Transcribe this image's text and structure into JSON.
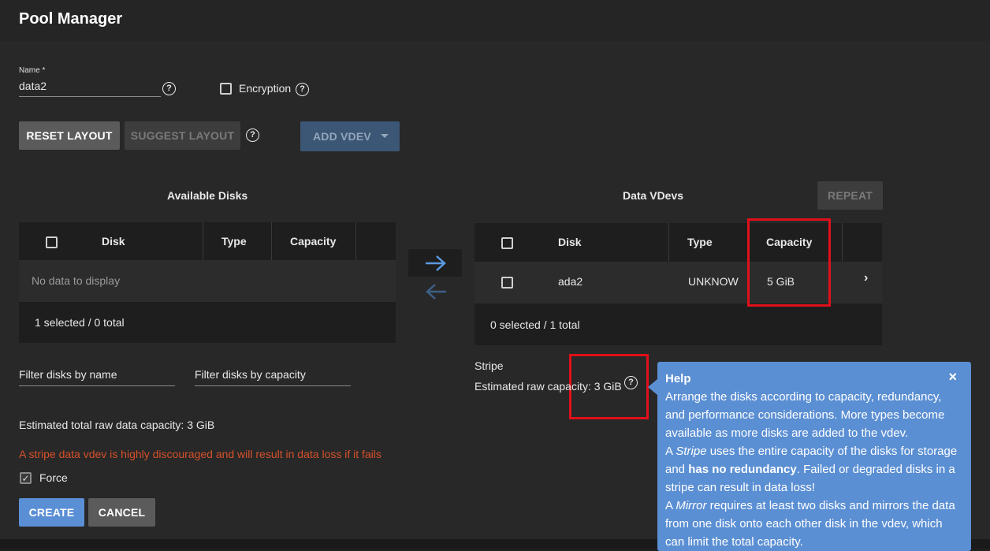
{
  "header": {
    "title": "Pool Manager"
  },
  "form": {
    "name_label": "Name *",
    "name_value": "data2",
    "encryption_label": "Encryption"
  },
  "toolbar": {
    "reset_layout": "RESET LAYOUT",
    "suggest_layout": "SUGGEST LAYOUT",
    "add_vdev": "ADD VDEV"
  },
  "available_disks": {
    "title": "Available Disks",
    "columns": [
      "Disk",
      "Type",
      "Capacity"
    ],
    "empty_text": "No data to display",
    "footer": "1 selected / 0 total",
    "filter_name_placeholder": "Filter disks by name",
    "filter_capacity_placeholder": "Filter disks by capacity",
    "estimated_total": "Estimated total raw data capacity: 3 GiB"
  },
  "data_vdevs": {
    "title": "Data VDevs",
    "repeat_label": "REPEAT",
    "columns": [
      "Disk",
      "Type",
      "Capacity"
    ],
    "rows": [
      {
        "disk": "ada2",
        "type": "UNKNOW",
        "capacity": "5 GiB"
      }
    ],
    "footer": "0 selected / 1 total",
    "vdev_type": "Stripe",
    "estimated_raw": "Estimated raw capacity: 3 GiB"
  },
  "warning": "A stripe data vdev is highly discouraged and will result in data loss if it fails",
  "force_label": "Force",
  "actions": {
    "create": "CREATE",
    "cancel": "CANCEL"
  },
  "help_popup": {
    "title": "Help",
    "close": "×",
    "p1": "Arrange the disks according to capacity, redundancy, and performance considerations. More types become available as more disks are added to the vdev.",
    "p2_prefix": "A ",
    "p2_term": "Stripe",
    "p2_mid": " uses the entire capacity of the disks for storage and ",
    "p2_bold": "has no redundancy",
    "p2_suffix": ". Failed or degraded disks in a stripe can result in data loss!",
    "p3_prefix": "A ",
    "p3_term": "Mirror",
    "p3_suffix": " requires at least two disks and mirrors the data from one disk onto each other disk in the vdev, which can limit the total capacity."
  },
  "colors": {
    "accent": "#5a8fd5",
    "warning": "#d5502a",
    "highlight": "#e0101a"
  }
}
